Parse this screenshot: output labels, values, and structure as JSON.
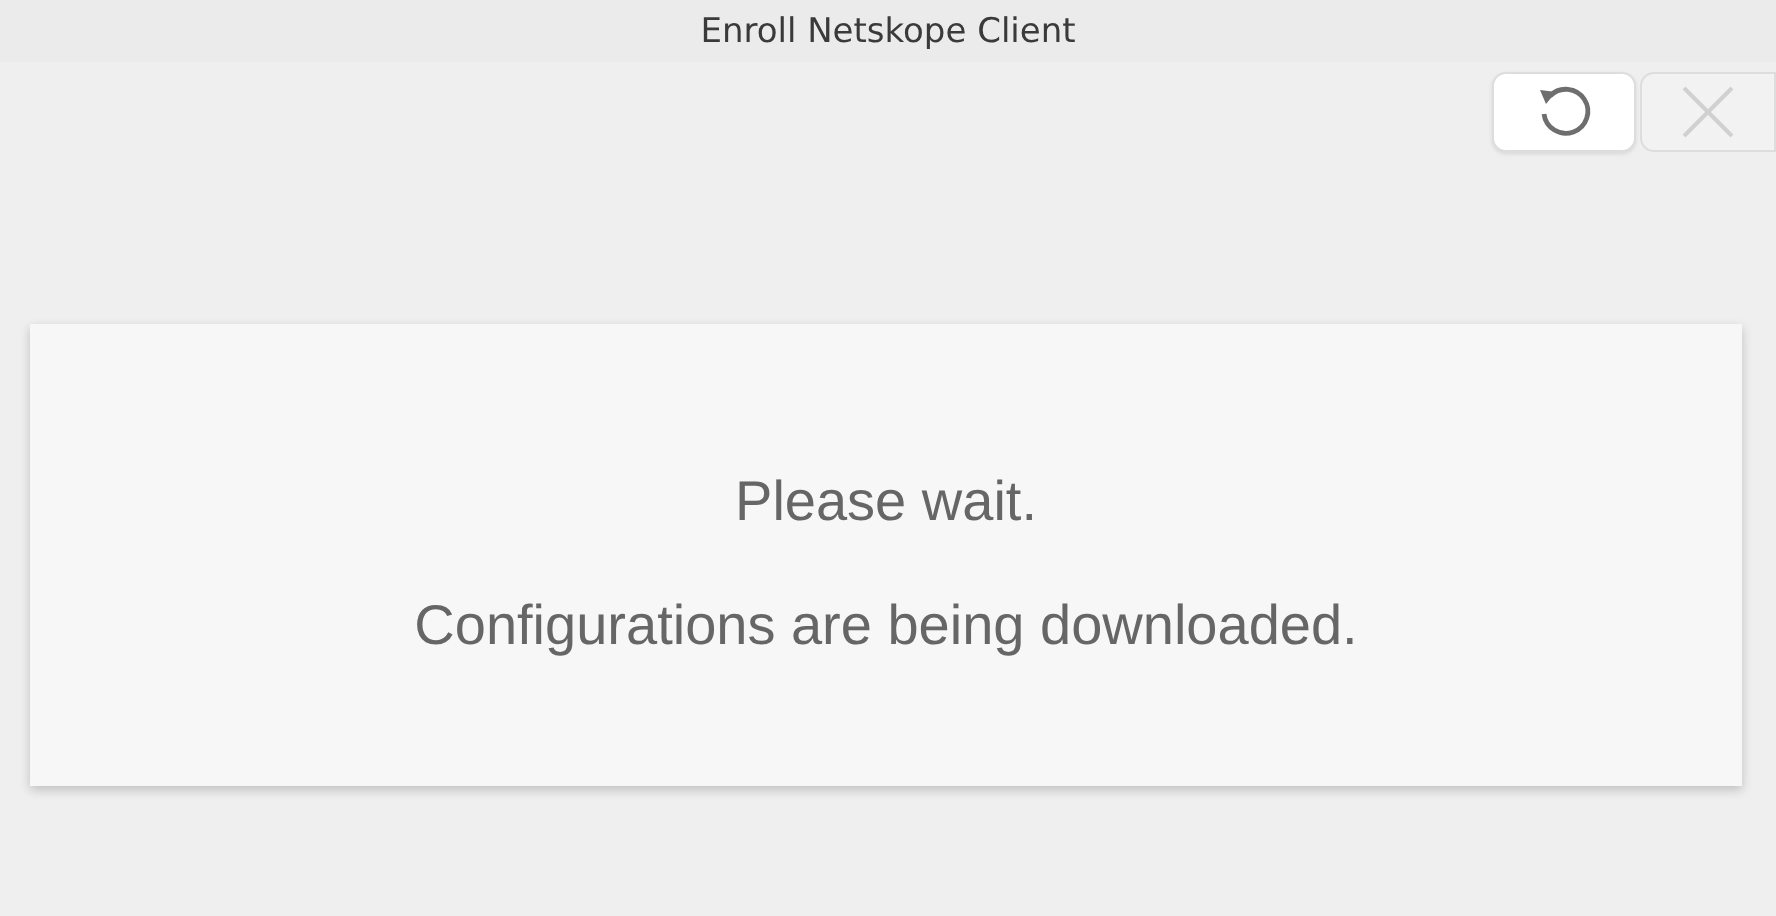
{
  "window": {
    "title": "Enroll Netskope Client"
  },
  "toolbar": [
    {
      "kind": "refresh",
      "disabled": false
    },
    {
      "kind": "close",
      "disabled": true
    }
  ],
  "message": {
    "lines": [
      "Please wait.",
      "Configurations are being downloaded."
    ]
  }
}
